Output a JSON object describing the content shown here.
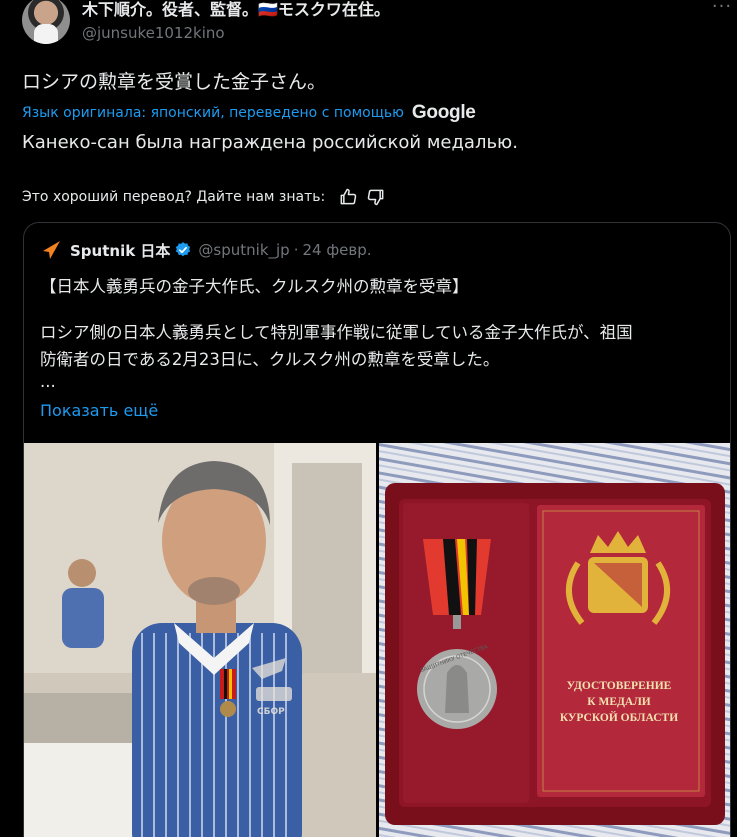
{
  "author": {
    "display_name": "木下順介。役者、監督。🇷🇺モスクワ在住。",
    "handle": "@junsuke1012kino"
  },
  "tweet": {
    "text": "ロシアの勲章を受賞した金子さん。",
    "translated_by": "Язык оригинала: японский, переведено с помощью",
    "translator_brand": "Google",
    "translation": "Канеко-сан была награждена российской медалью.",
    "feedback_prompt": "Это хороший перевод? Дайте нам знать:"
  },
  "quote": {
    "name": "Sputnik 日本",
    "handle": "@sputnik_jp",
    "separator": "·",
    "date": "24 февр.",
    "lines": [
      "【日本人義勇兵の金子大作氏、クルスク州の勲章を受章】",
      "ロシア側の日本人義勇兵として特別軍事作戦に従軍している金子大作氏が、祖国",
      "防衛者の日である2月23日に、クルスク州の勲章を受章した。",
      "..."
    ],
    "show_more": "Показать ещё"
  },
  "media": {
    "certificate_text": [
      "УДОСТОВЕРЕНИЕ",
      "К МЕДАЛИ",
      "КУРСКОЙ ОБЛАСТИ"
    ],
    "medal_inscription": "ЗАЩИТНИКУ ОТЕЧЕСТВА",
    "badge_text": "СБОР"
  },
  "colors": {
    "background": "#000000",
    "text": "#e7e9ea",
    "muted": "#71767b",
    "accent": "#1d9bf0",
    "border": "#2f3336",
    "sputnik": "#f58220"
  },
  "icons": {
    "more": "more-icon",
    "thumbs_up": "thumbs-up-icon",
    "thumbs_down": "thumbs-down-icon",
    "verified": "verified-badge-icon",
    "sputnik": "sputnik-logo-icon"
  }
}
